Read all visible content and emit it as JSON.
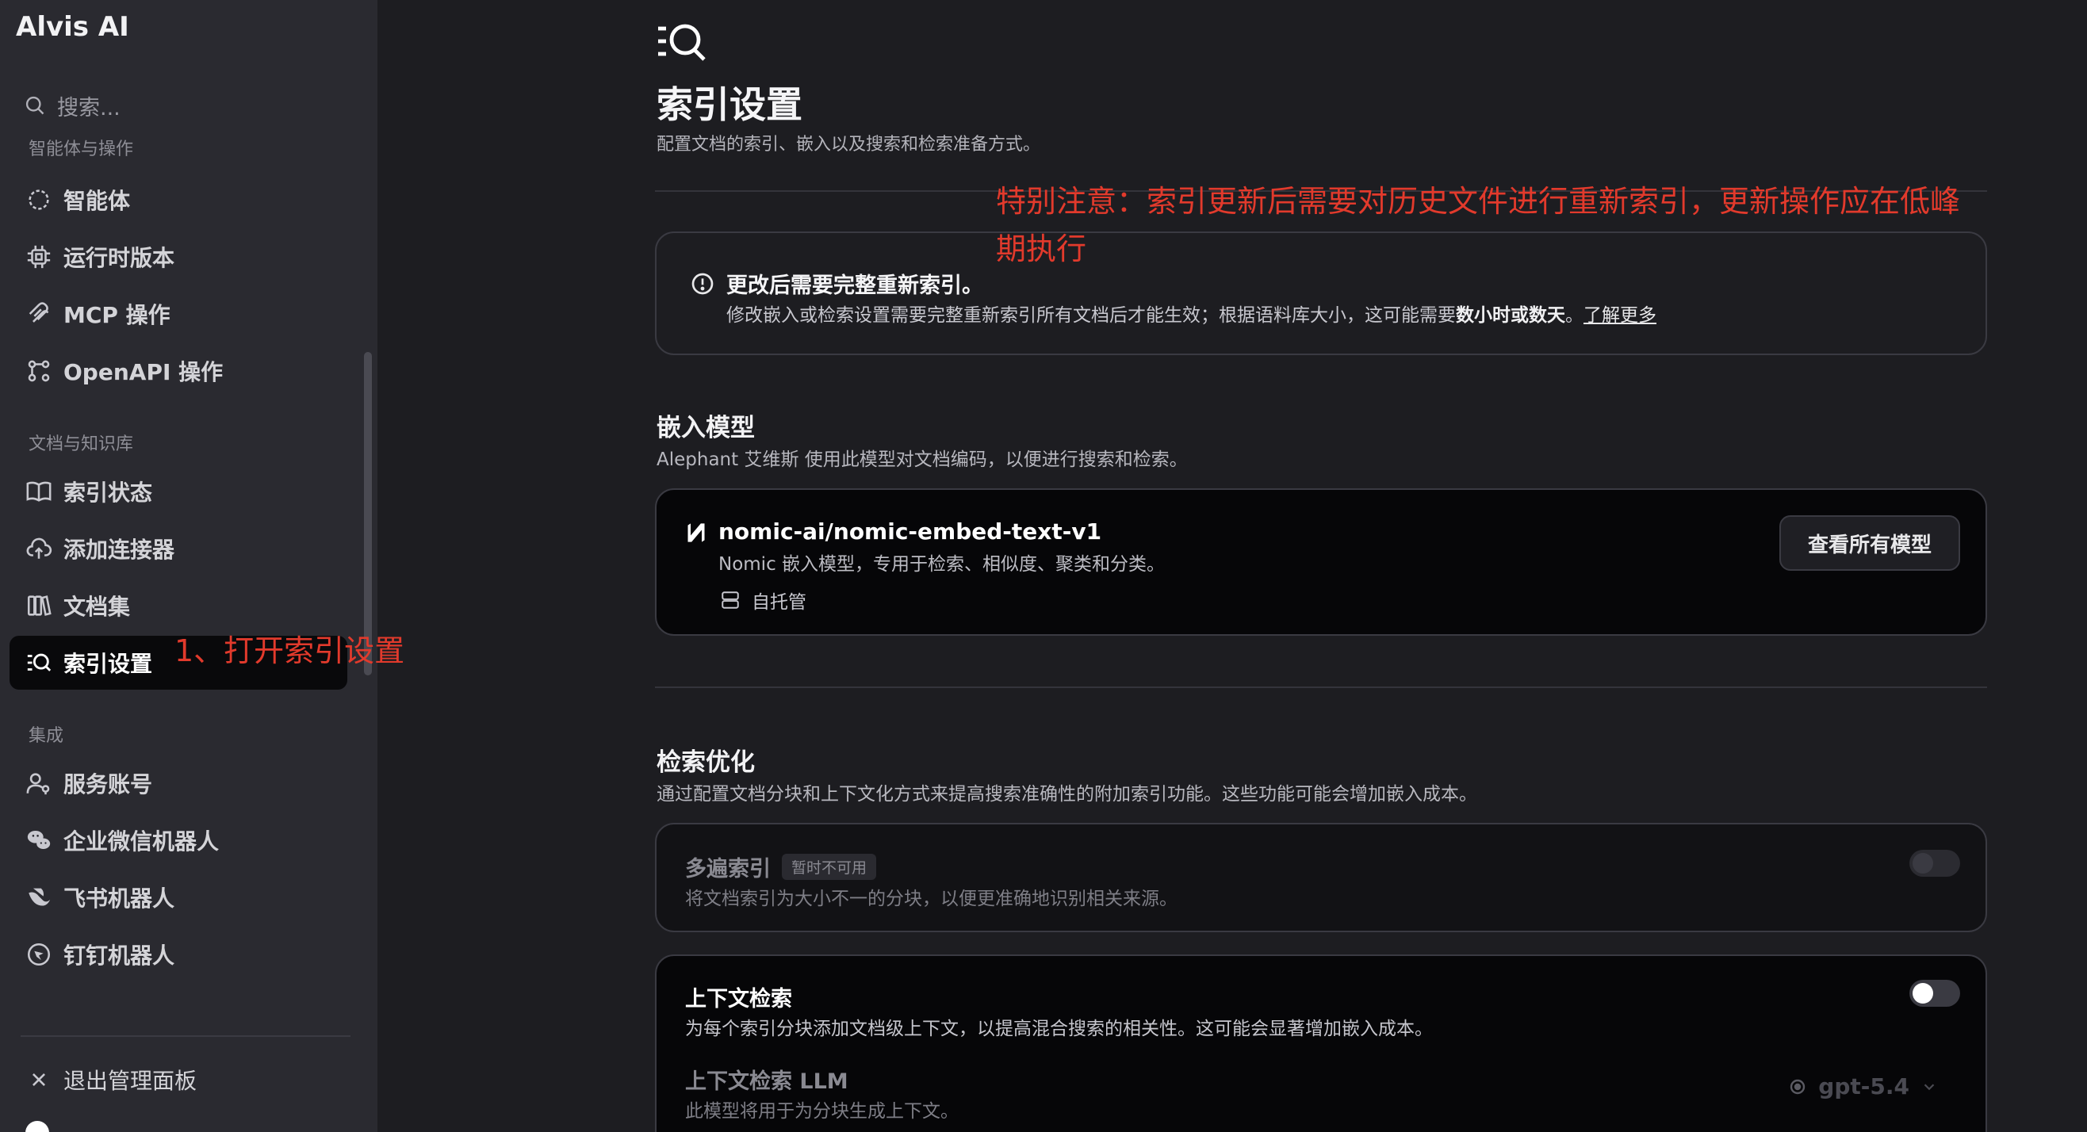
{
  "sidebar": {
    "brand": "Alvis AI",
    "search_placeholder": "搜索...",
    "section_agents": "智能体与操作",
    "items_agents": [
      {
        "label": "智能体",
        "icon": "agent-icon"
      },
      {
        "label": "运行时版本",
        "icon": "chip-icon"
      },
      {
        "label": "MCP 操作",
        "icon": "mcp-icon"
      },
      {
        "label": "OpenAPI 操作",
        "icon": "openapi-icon"
      }
    ],
    "section_docs": "文档与知识库",
    "items_docs": [
      {
        "label": "索引状态",
        "icon": "book-icon"
      },
      {
        "label": "添加连接器",
        "icon": "cloud-upload-icon"
      },
      {
        "label": "文档集",
        "icon": "doc-set-icon"
      },
      {
        "label": "索引设置",
        "icon": "index-search-icon",
        "active": true
      }
    ],
    "section_integrations": "集成",
    "items_integrations": [
      {
        "label": "服务账号",
        "icon": "user-key-icon"
      },
      {
        "label": "企业微信机器人",
        "icon": "wechat-icon"
      },
      {
        "label": "飞书机器人",
        "icon": "feishu-icon"
      },
      {
        "label": "钉钉机器人",
        "icon": "dingtalk-icon"
      }
    ],
    "exit_label": "退出管理面板",
    "annotation": "1、打开索引设置"
  },
  "main": {
    "title": "索引设置",
    "subtitle": "配置文档的索引、嵌入以及搜索和检索准备方式。",
    "annotation": "特别注意：索引更新后需要对历史文件进行重新索引，更新操作应在低峰期执行",
    "warning": {
      "title": "更改后需要完整重新索引。",
      "body_prefix": "修改嵌入或检索设置需要完整重新索引所有文档后才能生效；根据语料库大小，这可能需要",
      "body_bold": "数小时或数天",
      "body_suffix": "。",
      "link": "了解更多"
    },
    "embedding": {
      "title": "嵌入模型",
      "subtitle": "Alephant 艾维斯 使用此模型对文档编码，以便进行搜索和检索。",
      "model_name": "nomic-ai/nomic-embed-text-v1",
      "model_desc": "Nomic 嵌入模型，专用于检索、相似度、聚类和分类。",
      "host": "自托管",
      "view_all_button": "查看所有模型"
    },
    "retrieval": {
      "title": "检索优化",
      "subtitle": "通过配置文档分块和上下文化方式来提高搜索准确性的附加索引功能。这些功能可能会增加嵌入成本。",
      "multipass": {
        "title": "多遍索引",
        "badge": "暂时不可用",
        "desc": "将文档索引为大小不一的分块，以便更准确地识别相关来源。",
        "enabled": false,
        "disabled": true
      },
      "contextual": {
        "title": "上下文检索",
        "desc": "为每个索引分块添加文档级上下文，以提高混合搜索的相关性。这可能会显著增加嵌入成本。",
        "enabled": false,
        "llm_title": "上下文检索 LLM",
        "llm_desc": "此模型将用于为分块生成上下文。",
        "llm_value": "gpt-5.4"
      }
    }
  },
  "colors": {
    "background": "#1d1d21",
    "sidebar": "#2a2a30",
    "annotation_red": "#e23a2c",
    "active_item": "#09090b"
  }
}
